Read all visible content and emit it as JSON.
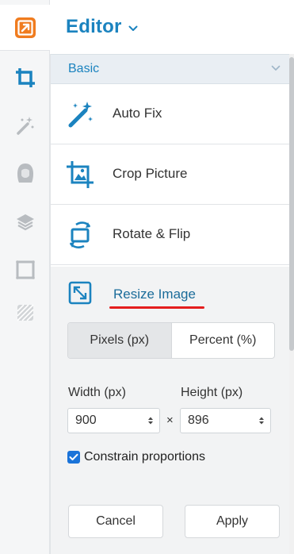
{
  "header": {
    "title": "Editor"
  },
  "rail": {
    "items": [
      {
        "icon": "app-logo-icon"
      },
      {
        "icon": "crop-icon",
        "active": true
      },
      {
        "icon": "magic-wand-icon"
      },
      {
        "icon": "portrait-icon"
      },
      {
        "icon": "layers-icon"
      },
      {
        "icon": "frame-icon"
      },
      {
        "icon": "texture-icon"
      }
    ]
  },
  "panel": {
    "section_label": "Basic",
    "tools": [
      {
        "label": "Auto Fix",
        "icon": "magic-wand-icon"
      },
      {
        "label": "Crop Picture",
        "icon": "crop-picture-icon"
      },
      {
        "label": "Rotate & Flip",
        "icon": "rotate-icon"
      }
    ],
    "resize": {
      "label": "Resize Image",
      "icon": "resize-icon",
      "units": [
        {
          "label": "Pixels (px)",
          "active": true
        },
        {
          "label": "Percent (%)",
          "active": false
        }
      ],
      "width_label": "Width (px)",
      "height_label": "Height (px)",
      "width_value": "900",
      "height_value": "896",
      "times_sign": "×",
      "constrain_label": "Constrain proportions",
      "constrain_checked": true,
      "cancel_label": "Cancel",
      "apply_label": "Apply"
    }
  },
  "colors": {
    "accent": "#1b83bf",
    "underline": "#e41d1d",
    "checkbox": "#1a73d9",
    "logo": "#f07c1f"
  }
}
